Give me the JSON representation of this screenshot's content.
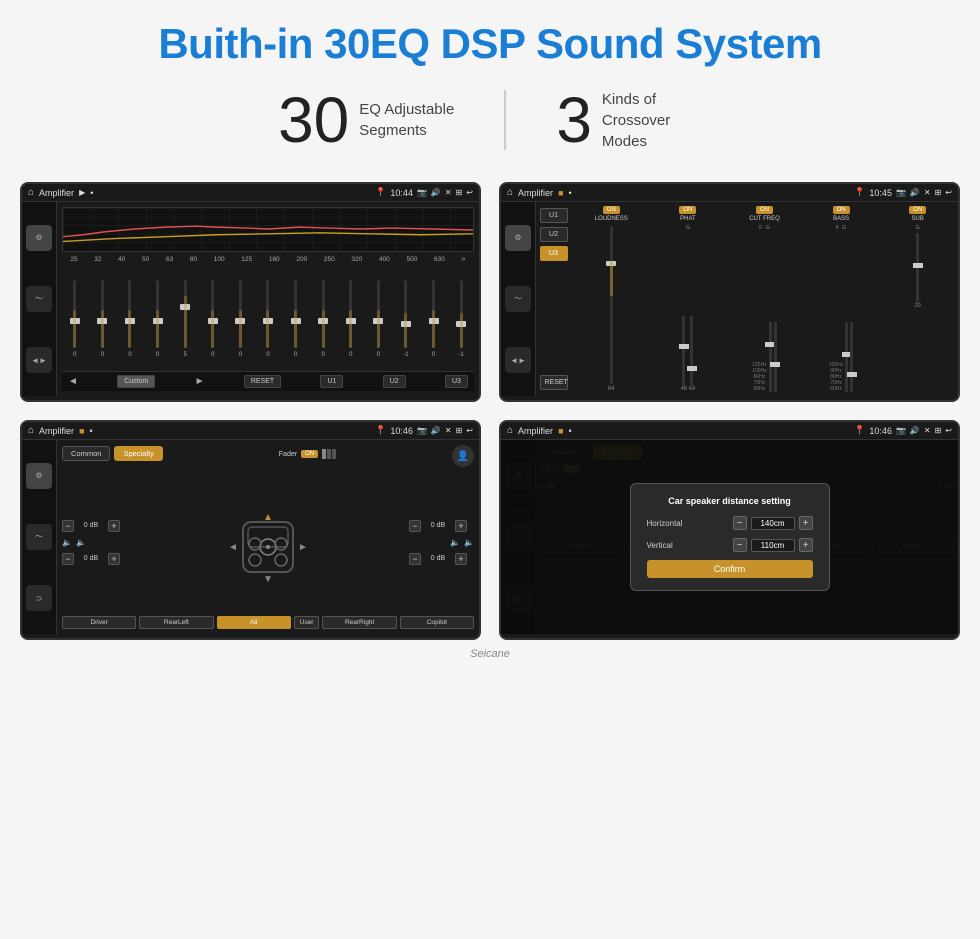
{
  "page": {
    "title": "Buith-in 30EQ DSP Sound System",
    "stat1_number": "30",
    "stat1_label": "EQ Adjustable\nSegments",
    "stat2_number": "3",
    "stat2_label": "Kinds of\nCrossover Modes"
  },
  "screen1": {
    "topbar_title": "Amplifier",
    "time": "10:44",
    "freq_labels": [
      "25",
      "32",
      "40",
      "50",
      "63",
      "80",
      "100",
      "125",
      "160",
      "200",
      "250",
      "320",
      "400",
      "500",
      "630"
    ],
    "slider_values": [
      "0",
      "0",
      "0",
      "0",
      "5",
      "0",
      "0",
      "0",
      "0",
      "0",
      "0",
      "0",
      "-1",
      "0",
      "-1"
    ],
    "bottom_buttons": [
      "Custom",
      "RESET",
      "U1",
      "U2",
      "U3"
    ]
  },
  "screen2": {
    "topbar_title": "Amplifier",
    "time": "10:45",
    "presets": [
      "U1",
      "U2",
      "U3"
    ],
    "channels": [
      "LOUDNESS",
      "PHAT",
      "CUT FREQ",
      "BASS",
      "SUB"
    ],
    "on_label": "ON",
    "reset_label": "RESET"
  },
  "screen3": {
    "topbar_title": "Amplifier",
    "time": "10:46",
    "tabs": [
      "Common",
      "Specialty"
    ],
    "fader_label": "Fader",
    "on_label": "ON",
    "db_values": [
      "0 dB",
      "0 dB",
      "0 dB",
      "0 dB"
    ],
    "speaker_buttons": [
      "Driver",
      "RearLeft",
      "All",
      "User",
      "RearRight",
      "Copilot"
    ]
  },
  "screen4": {
    "topbar_title": "Amplifier",
    "time": "10:46",
    "dialog_title": "Car speaker distance setting",
    "horizontal_label": "Horizontal",
    "horizontal_value": "140cm",
    "vertical_label": "Vertical",
    "vertical_value": "110cm",
    "confirm_label": "Confirm",
    "db_values": [
      "0 dB",
      "0 dB"
    ],
    "speaker_buttons": [
      "Driver",
      "RearLeft",
      "All",
      "User",
      "RearRight",
      "Copilot"
    ]
  },
  "watermark": "Seicane"
}
